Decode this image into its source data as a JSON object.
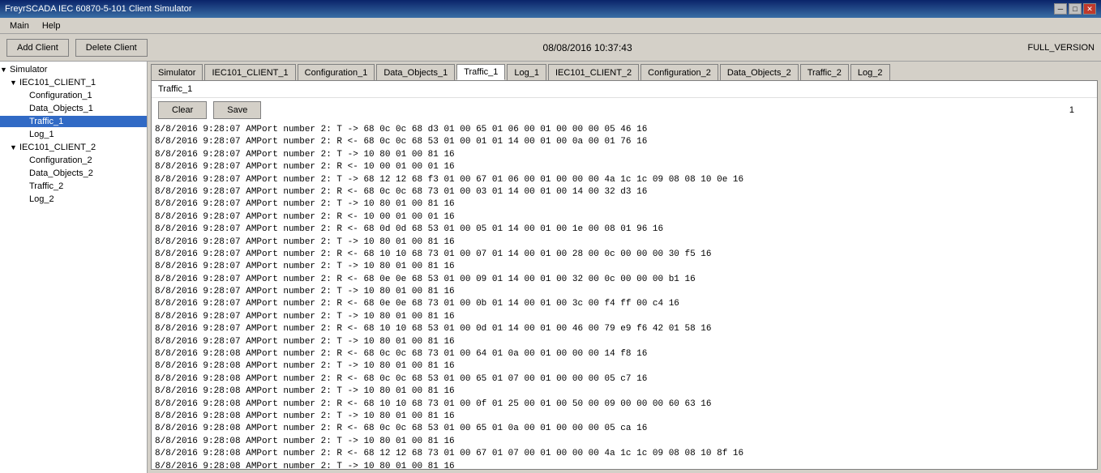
{
  "titlebar": {
    "title": "FreyrSCADA IEC 60870-5-101 Client Simulator",
    "controls": {
      "minimize": "─",
      "maximize": "□",
      "close": "✕"
    }
  },
  "menubar": {
    "items": [
      "Main",
      "Help"
    ]
  },
  "toolbar": {
    "add_client": "Add Client",
    "delete_client": "Delete Client",
    "datetime": "08/08/2016 10:37:43",
    "version": "FULL_VERSION"
  },
  "sidebar": {
    "tree": [
      {
        "id": "simulator",
        "label": "Simulator",
        "level": 0,
        "expanded": true,
        "icon": "▼"
      },
      {
        "id": "iec101_client_1",
        "label": "IEC101_CLIENT_1",
        "level": 1,
        "expanded": true,
        "icon": "▼"
      },
      {
        "id": "configuration_1",
        "label": "Configuration_1",
        "level": 2,
        "icon": ""
      },
      {
        "id": "data_objects_1",
        "label": "Data_Objects_1",
        "level": 2,
        "icon": ""
      },
      {
        "id": "traffic_1",
        "label": "Traffic_1",
        "level": 2,
        "icon": "",
        "selected": true
      },
      {
        "id": "log_1",
        "label": "Log_1",
        "level": 2,
        "icon": ""
      },
      {
        "id": "iec101_client_2",
        "label": "IEC101_CLIENT_2",
        "level": 1,
        "expanded": true,
        "icon": "▼"
      },
      {
        "id": "configuration_2",
        "label": "Configuration_2",
        "level": 2,
        "icon": ""
      },
      {
        "id": "data_objects_2",
        "label": "Data_Objects_2",
        "level": 2,
        "icon": ""
      },
      {
        "id": "traffic_2",
        "label": "Traffic_2",
        "level": 2,
        "icon": ""
      },
      {
        "id": "log_2",
        "label": "Log_2",
        "level": 2,
        "icon": ""
      }
    ]
  },
  "tabs": [
    {
      "id": "simulator",
      "label": "Simulator"
    },
    {
      "id": "iec101_client_1",
      "label": "IEC101_CLIENT_1"
    },
    {
      "id": "configuration_1",
      "label": "Configuration_1"
    },
    {
      "id": "data_objects_1",
      "label": "Data_Objects_1"
    },
    {
      "id": "traffic_1",
      "label": "Traffic_1",
      "active": true
    },
    {
      "id": "log_1",
      "label": "Log_1"
    },
    {
      "id": "iec101_client_2",
      "label": "IEC101_CLIENT_2"
    },
    {
      "id": "configuration_2",
      "label": "Configuration_2"
    },
    {
      "id": "data_objects_2",
      "label": "Data_Objects_2"
    },
    {
      "id": "traffic_2",
      "label": "Traffic_2"
    },
    {
      "id": "log_2",
      "label": "Log_2"
    }
  ],
  "traffic_panel": {
    "title": "Traffic_1",
    "clear_btn": "Clear",
    "save_btn": "Save",
    "counter": "1",
    "log_lines": [
      "8/8/2016 9:28:07 AMPort number 2:  T ->  68 0c 0c 68 d3 01 00 65 01 06 00 01 00 00 00 05 46 16",
      "8/8/2016 9:28:07 AMPort number 2:  R <- 68 0c 0c 68 53 01 00 01 01 14 00 01 00 0a 00 01 76 16",
      "8/8/2016 9:28:07 AMPort number 2:  T ->  10 80 01 00 81 16",
      "8/8/2016 9:28:07 AMPort number 2:  R <- 10 00 01 00 01 16",
      "8/8/2016 9:28:07 AMPort number 2:  T ->  68 12 12 68 f3 01 00 67 01 06 00 01 00 00 00 4a 1c 1c 09 08 08 10 0e 16",
      "8/8/2016 9:28:07 AMPort number 2:  R <- 68 0c 0c 68 73 01 00 03 01 14 00 01 00 14 00 32 d3 16",
      "8/8/2016 9:28:07 AMPort number 2:  T ->  10 80 01 00 81 16",
      "8/8/2016 9:28:07 AMPort number 2:  R <- 10 00 01 00 01 16",
      "8/8/2016 9:28:07 AMPort number 2:  R <- 68 0d 0d 68 53 01 00 05 01 14 00 01 00 1e 00 08 01 96 16",
      "8/8/2016 9:28:07 AMPort number 2:  T ->  10 80 01 00 81 16",
      "8/8/2016 9:28:07 AMPort number 2:  R <- 68 10 10 68 73 01 00 07 01 14 00 01 00 28 00 0c 00 00 00 30 f5 16",
      "8/8/2016 9:28:07 AMPort number 2:  T ->  10 80 01 00 81 16",
      "8/8/2016 9:28:07 AMPort number 2:  R <- 68 0e 0e 68 53 01 00 09 01 14 00 01 00 32 00 0c 00 00 00 b1 16",
      "8/8/2016 9:28:07 AMPort number 2:  T ->  10 80 01 00 81 16",
      "8/8/2016 9:28:07 AMPort number 2:  R <- 68 0e 0e 68 73 01 00 0b 01 14 00 01 00 3c 00 f4 ff 00 c4 16",
      "8/8/2016 9:28:07 AMPort number 2:  T ->  10 80 01 00 81 16",
      "8/8/2016 9:28:07 AMPort number 2:  R <- 68 10 10 68 53 01 00 0d 01 14 00 01 00 46 00 79 e9 f6 42 01 58 16",
      "8/8/2016 9:28:07 AMPort number 2:  T ->  10 80 01 00 81 16",
      "8/8/2016 9:28:08 AMPort number 2:  R <- 68 0c 0c 68 73 01 00 64 01 0a 00 01 00 00 00 14 f8 16",
      "8/8/2016 9:28:08 AMPort number 2:  T ->  10 80 01 00 81 16",
      "8/8/2016 9:28:08 AMPort number 2:  R <- 68 0c 0c 68 53 01 00 65 01 07 00 01 00 00 00 05 c7 16",
      "8/8/2016 9:28:08 AMPort number 2:  T ->  10 80 01 00 81 16",
      "8/8/2016 9:28:08 AMPort number 2:  R <- 68 10 10 68 73 01 00 0f 01 25 00 01 00 50 00 09 00 00 00 60 63 16",
      "8/8/2016 9:28:08 AMPort number 2:  T ->  10 80 01 00 81 16",
      "8/8/2016 9:28:08 AMPort number 2:  R <- 68 0c 0c 68 53 01 00 65 01 0a 00 01 00 00 00 05 ca 16",
      "8/8/2016 9:28:08 AMPort number 2:  T ->  10 80 01 00 81 16",
      "8/8/2016 9:28:08 AMPort number 2:  R <- 68 12 12 68 73 01 00 67 01 07 00 01 00 00 00 4a 1c 1c 09 08 08 10 8f 16",
      "8/8/2016 9:28:08 AMPort number 2:  T ->  10 80 01 00 81 16"
    ]
  }
}
